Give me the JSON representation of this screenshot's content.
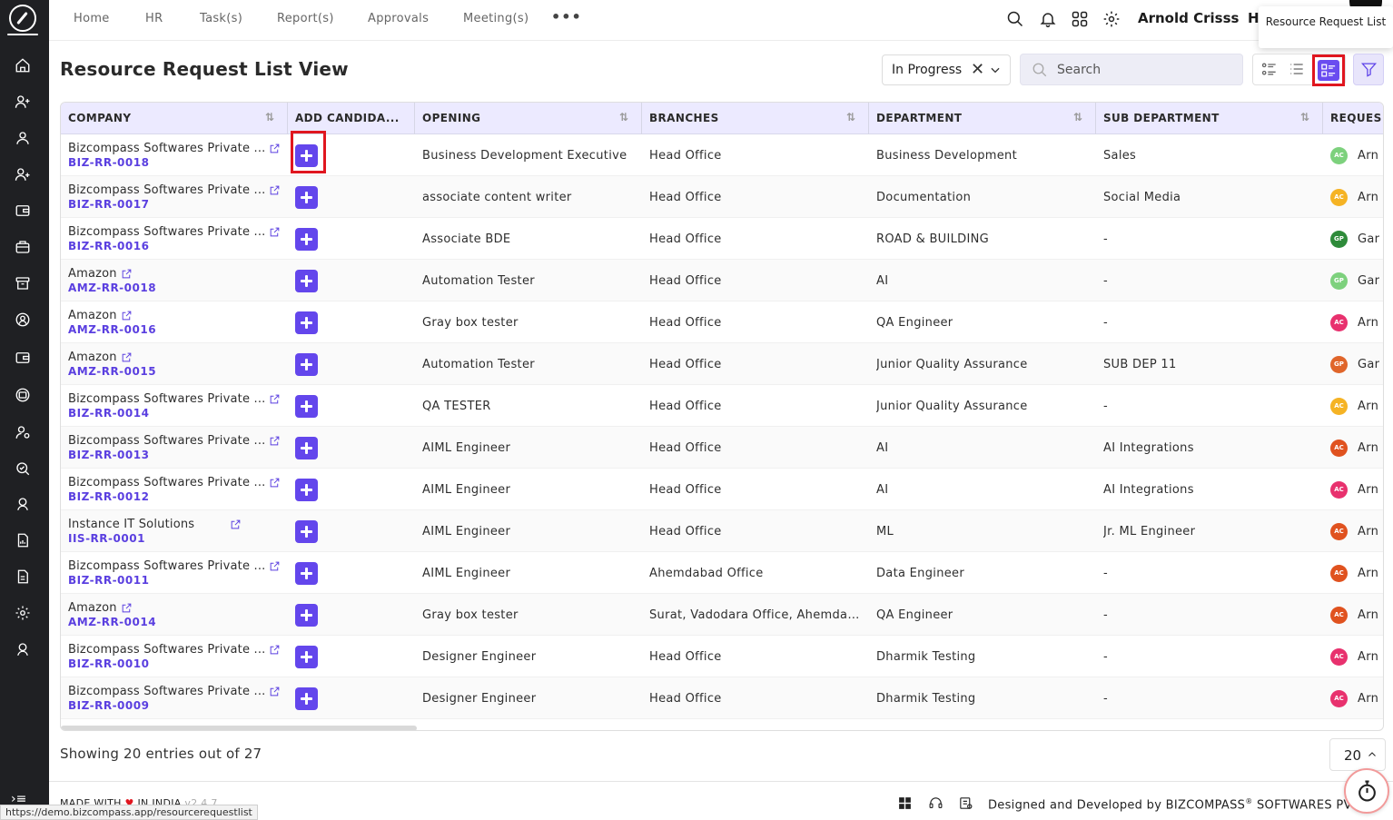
{
  "nav": {
    "items": [
      "Home",
      "HR",
      "Task(s)",
      "Report(s)",
      "Approvals",
      "Meeting(s)"
    ],
    "more": "•••",
    "user_name": "Arnold Crisss",
    "user_extra": "H",
    "tooltip": "Resource Request List"
  },
  "page": {
    "title": "Resource Request List View",
    "status_filter": "In Progress",
    "clear_symbol": "✕",
    "search_placeholder": "Search"
  },
  "table": {
    "columns": [
      "COMPANY",
      "ADD CANDIDA...",
      "OPENING",
      "BRANCHES",
      "DEPARTMENT",
      "SUB DEPARTMENT",
      "REQUES"
    ],
    "rows": [
      {
        "company": "Bizcompass Softwares Private ...",
        "code": "BIZ-RR-0018",
        "opening": "Business Development Executive",
        "branch": "Head Office",
        "department": "Business Development",
        "sub_department": "Sales",
        "initials": "AC",
        "avatar_color": "#7dd17d",
        "requester": "Arn"
      },
      {
        "company": "Bizcompass Softwares Private ...",
        "code": "BIZ-RR-0017",
        "opening": "associate content writer",
        "branch": "Head Office",
        "department": "Documentation",
        "sub_department": "Social Media",
        "initials": "AC",
        "avatar_color": "#f5b324",
        "requester": "Arn"
      },
      {
        "company": "Bizcompass Softwares Private ...",
        "code": "BIZ-RR-0016",
        "opening": "Associate BDE",
        "branch": "Head Office",
        "department": "ROAD & BUILDING",
        "sub_department": "-",
        "initials": "GP",
        "avatar_color": "#2e8b3a",
        "requester": "Gar"
      },
      {
        "company": "Amazon",
        "code": "AMZ-RR-0018",
        "opening": "Automation Tester",
        "branch": "Head Office",
        "department": "AI",
        "sub_department": "-",
        "initials": "GP",
        "avatar_color": "#7dd17d",
        "requester": "Gar"
      },
      {
        "company": "Amazon",
        "code": "AMZ-RR-0016",
        "opening": "Gray box tester",
        "branch": "Head Office",
        "department": "QA Engineer",
        "sub_department": "-",
        "initials": "AC",
        "avatar_color": "#e8316e",
        "requester": "Arn"
      },
      {
        "company": "Amazon",
        "code": "AMZ-RR-0015",
        "opening": "Automation Tester",
        "branch": "Head Office",
        "department": "Junior Quality Assurance",
        "sub_department": "SUB DEP 11",
        "initials": "GP",
        "avatar_color": "#e0652a",
        "requester": "Gar"
      },
      {
        "company": "Bizcompass Softwares Private ...",
        "code": "BIZ-RR-0014",
        "opening": "QA TESTER",
        "branch": "Head Office",
        "department": "Junior Quality Assurance",
        "sub_department": "-",
        "initials": "AC",
        "avatar_color": "#f5b324",
        "requester": "Arn"
      },
      {
        "company": "Bizcompass Softwares Private ...",
        "code": "BIZ-RR-0013",
        "opening": "AIML Engineer",
        "branch": "Head Office",
        "department": "AI",
        "sub_department": "AI Integrations",
        "initials": "AC",
        "avatar_color": "#e0521f",
        "requester": "Arn"
      },
      {
        "company": "Bizcompass Softwares Private ...",
        "code": "BIZ-RR-0012",
        "opening": "AIML Engineer",
        "branch": "Head Office",
        "department": "AI",
        "sub_department": "AI Integrations",
        "initials": "AC",
        "avatar_color": "#e8316e",
        "requester": "Arn"
      },
      {
        "company": "Instance IT Solutions",
        "code": "IIS-RR-0001",
        "opening": "AIML Engineer",
        "branch": "Head Office",
        "department": "ML",
        "sub_department": "Jr. ML Engineer",
        "initials": "AC",
        "avatar_color": "#e0521f",
        "requester": "Arn"
      },
      {
        "company": "Bizcompass Softwares Private ...",
        "code": "BIZ-RR-0011",
        "opening": "AIML Engineer",
        "branch": "Ahemdabad Office",
        "department": "Data Engineer",
        "sub_department": "-",
        "initials": "AC",
        "avatar_color": "#e0521f",
        "requester": "Arn"
      },
      {
        "company": "Amazon",
        "code": "AMZ-RR-0014",
        "opening": "Gray box tester",
        "branch": "Surat, Vadodara Office, Ahemdaba...",
        "department": "QA Engineer",
        "sub_department": "-",
        "initials": "AC",
        "avatar_color": "#e0521f",
        "requester": "Arn"
      },
      {
        "company": "Bizcompass Softwares Private ...",
        "code": "BIZ-RR-0010",
        "opening": "Designer Engineer",
        "branch": "Head Office",
        "department": "Dharmik Testing",
        "sub_department": "-",
        "initials": "AC",
        "avatar_color": "#e8316e",
        "requester": "Arn"
      },
      {
        "company": "Bizcompass Softwares Private ...",
        "code": "BIZ-RR-0009",
        "opening": "Designer Engineer",
        "branch": "Head Office",
        "department": "Dharmik Testing",
        "sub_department": "-",
        "initials": "AC",
        "avatar_color": "#e8316e",
        "requester": "Arn"
      }
    ]
  },
  "pagination": {
    "summary": "Showing 20 entries out of 27",
    "page_size": "20"
  },
  "footer": {
    "made_with": "MADE WITH",
    "heart": "♥",
    "in_india": "IN INDIA",
    "version": "v2.4.7",
    "designed_by": "Designed and Developed by",
    "company": "BIZCOMPASS",
    "reg": "®",
    "company_suffix": "SOFTWARES PV",
    "status_url": "https://demo.bizcompass.app/resourcerequestlist"
  },
  "colors": {
    "accent": "#6346ec",
    "header_bg": "#eceaff",
    "highlight": "#e0161f",
    "rail_bg": "#1f2023"
  }
}
